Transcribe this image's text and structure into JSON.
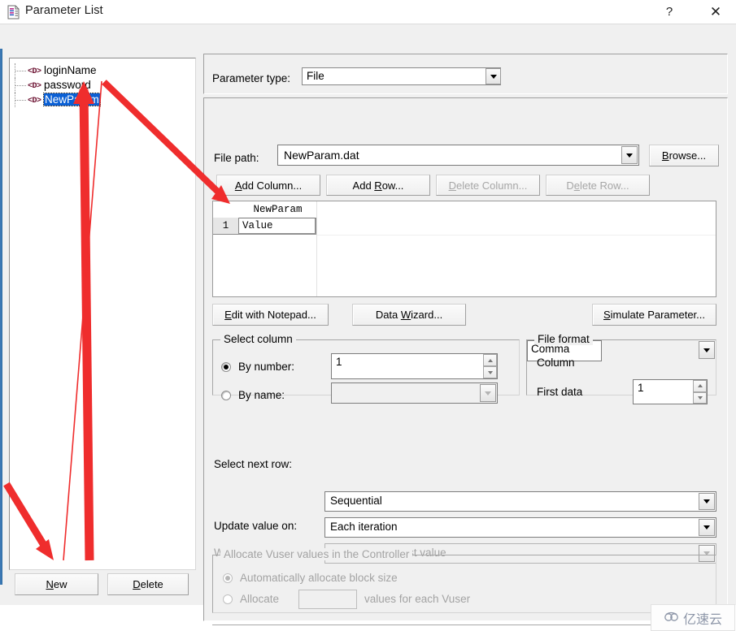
{
  "window": {
    "title": "Parameter List",
    "icon": "parameter-list-icon",
    "help_label": "?",
    "close_label": "✕"
  },
  "tree": {
    "items": [
      {
        "icon": "<D>",
        "label": "loginName",
        "selected": false
      },
      {
        "icon": "<D>",
        "label": "password",
        "selected": false
      },
      {
        "icon": "<D>",
        "label": "NewParam",
        "selected": true
      }
    ]
  },
  "list_buttons": {
    "new": "New",
    "new_mnemonic": "N",
    "delete": "Delete",
    "delete_mnemonic": "D"
  },
  "parameter_type": {
    "label": "Parameter type:",
    "value": "File"
  },
  "file_path": {
    "label": "File path:",
    "value": "NewParam.dat",
    "browse": "Browse..."
  },
  "grid_buttons": {
    "add_column": "Add Column...",
    "add_row": "Add Row...",
    "delete_column": "Delete Column...",
    "delete_row": "Delete Row..."
  },
  "grid": {
    "column_header": "NewParam",
    "row_number": "1",
    "cell_value": "Value"
  },
  "tool_buttons": {
    "edit_notepad": "Edit with Notepad...",
    "data_wizard": "Data Wizard...",
    "simulate_parameter": "Simulate Parameter..."
  },
  "select_column": {
    "legend": "Select column",
    "by_number_label": "By number:",
    "by_number_value": "1",
    "by_number_selected": true,
    "by_name_label": "By name:",
    "by_name_value": "",
    "by_name_selected": false
  },
  "file_format": {
    "legend": "File format",
    "column_label": "Column",
    "column_value": "Comma",
    "first_data_label": "First data",
    "first_data_value": "1"
  },
  "next_row": {
    "label": "Select next row:",
    "value": "Sequential",
    "update_label": "Update value on:",
    "update_value": "Each iteration",
    "when_out_label": "When out of values:",
    "when_out_value": "Continue with last value"
  },
  "allocate": {
    "legend": "Allocate Vuser values in the Controller",
    "auto_label": "Automatically allocate block size",
    "auto_selected": true,
    "manual_label": "Allocate",
    "manual_value": "",
    "manual_suffix": "values for each Vuser",
    "manual_selected": false
  },
  "watermark": {
    "text": "亿速云",
    "icon": "cloud-icon"
  },
  "colors": {
    "accent": "#0a5fd4",
    "annotation": "#ef2d2d",
    "dialog_bg": "#f0f0f0",
    "tree_icon": "#6b1030"
  }
}
